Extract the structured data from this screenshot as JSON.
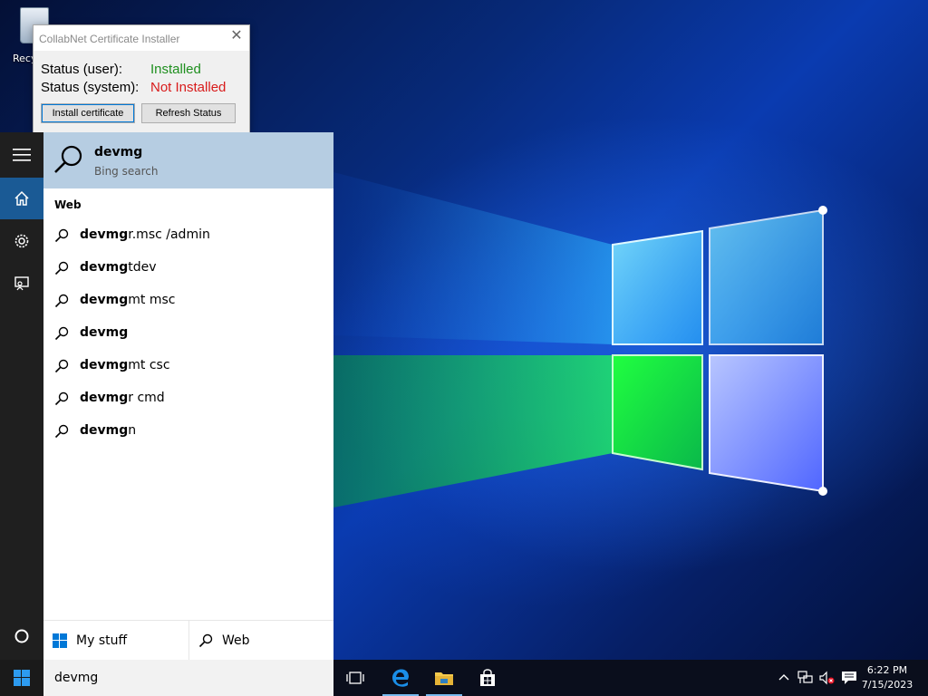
{
  "desktop": {
    "recycle_bin_label": "Recyc"
  },
  "cert_installer": {
    "title": "CollabNet Certificate Installer",
    "status_user_label": "Status (user):",
    "status_user_value": "Installed",
    "status_system_label": "Status (system):",
    "status_system_value": "Not Installed",
    "install_button": "Install certificate",
    "refresh_button": "Refresh Status",
    "colors": {
      "installed": "#1e8f1e",
      "not_installed": "#d81b1b"
    }
  },
  "start_rail": {
    "items": [
      {
        "icon": "hamburger-menu-icon"
      },
      {
        "icon": "home-icon",
        "active": true
      },
      {
        "icon": "gear-icon"
      },
      {
        "icon": "feedback-icon"
      }
    ],
    "bottom_icon": "cortana-circle-icon"
  },
  "search_panel": {
    "best_match": {
      "title": "devmg",
      "subtitle": "Bing search"
    },
    "section_header": "Web",
    "suggestions": [
      {
        "bold": "devmg",
        "rest": "r.msc /admin"
      },
      {
        "bold": "devmg",
        "rest": "tdev"
      },
      {
        "bold": "devmg",
        "rest": "mt msc"
      },
      {
        "bold": "devmg",
        "rest": ""
      },
      {
        "bold": "devmg",
        "rest": "mt csc"
      },
      {
        "bold": "devmg",
        "rest": "r cmd"
      },
      {
        "bold": "devmg",
        "rest": "n"
      }
    ],
    "filters": {
      "my_stuff": "My stuff",
      "web": "Web"
    }
  },
  "taskbar": {
    "search_query": "devmg",
    "apps": [
      "task-view-icon",
      "edge-icon",
      "file-explorer-icon",
      "store-icon"
    ],
    "clock": {
      "time": "6:22 PM",
      "date": "7/15/2023"
    }
  }
}
